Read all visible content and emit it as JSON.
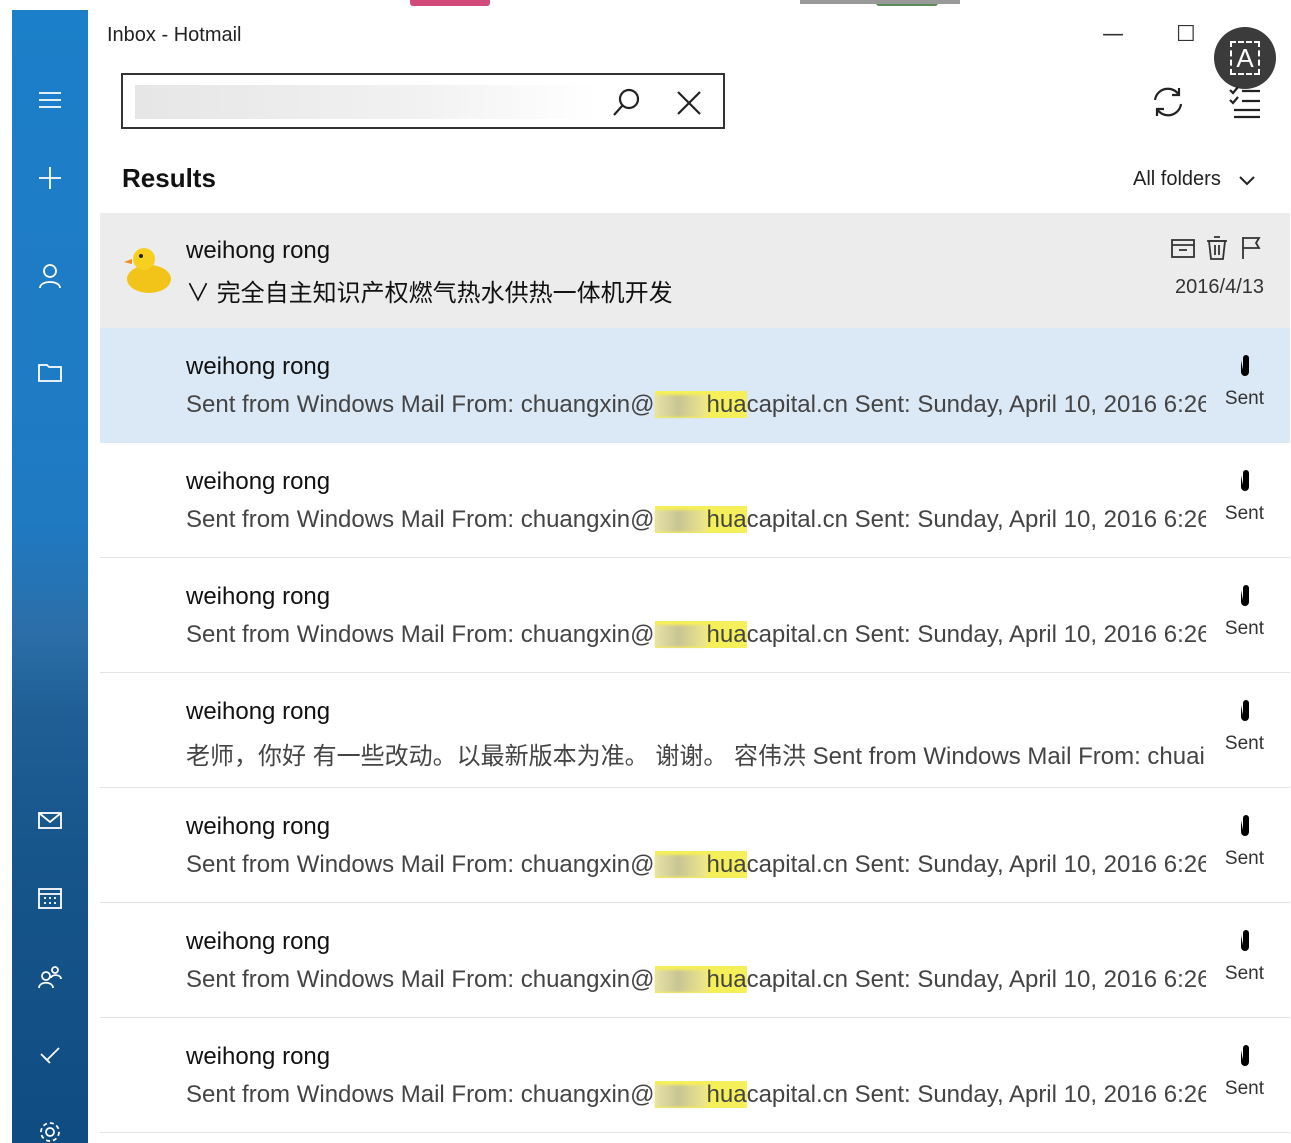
{
  "window": {
    "title": "Inbox - Hotmail",
    "minimize_glyph": "—",
    "maximize_glyph": "☐",
    "avatar_glyph": "A"
  },
  "rail": {
    "items": [
      {
        "icon": "hamburger-icon"
      },
      {
        "icon": "plus-icon"
      },
      {
        "icon": "person-icon"
      },
      {
        "icon": "folder-icon"
      },
      {
        "icon": "mail-icon"
      },
      {
        "icon": "calendar-icon"
      },
      {
        "icon": "people-icon"
      },
      {
        "icon": "todo-icon"
      },
      {
        "icon": "gear-icon"
      }
    ],
    "colors": {
      "top": "#1c7fc9",
      "bottom": "#0f4c82"
    }
  },
  "search": {
    "value": "",
    "placeholder": ""
  },
  "results_header": {
    "title": "Results",
    "folder_filter": "All folders"
  },
  "messages": [
    {
      "sender": "weihong rong",
      "subject": "∨ 完全自主知识产权燃气热水供热一体机开发",
      "date": "2016/4/13"
    },
    {
      "sender": "weihong rong",
      "preview_pre": "Sent from Windows Mail From: chuangxin@",
      "preview_hl": "hua",
      "preview_post": "capital.cn Sent: Sunday, April 10, 2016 6:26",
      "folder": "Sent"
    },
    {
      "sender": "weihong rong",
      "preview_pre": "Sent from Windows Mail From: chuangxin@",
      "preview_hl": "hua",
      "preview_post": "capital.cn Sent: Sunday, April 10, 2016 6:26",
      "folder": "Sent"
    },
    {
      "sender": "weihong rong",
      "preview_pre": "Sent from Windows Mail From: chuangxin@",
      "preview_hl": "hua",
      "preview_post": "capital.cn Sent: Sunday, April 10, 2016 6:26",
      "folder": "Sent"
    },
    {
      "sender": "weihong rong",
      "preview_text": "老师，你好 有一些改动。以最新版本为准。 谢谢。 容伟洪 Sent from Windows Mail From: chuai",
      "folder": "Sent"
    },
    {
      "sender": "weihong rong",
      "preview_pre": "Sent from Windows Mail From: chuangxin@",
      "preview_hl": "hua",
      "preview_post": "capital.cn Sent: Sunday, April 10, 2016 6:26",
      "folder": "Sent"
    },
    {
      "sender": "weihong rong",
      "preview_pre": "Sent from Windows Mail From: chuangxin@",
      "preview_hl": "hua",
      "preview_post": "capital.cn Sent: Sunday, April 10, 2016 6:26",
      "folder": "Sent"
    },
    {
      "sender": "weihong rong",
      "preview_pre": "Sent from Windows Mail From: chuangxin@",
      "preview_hl": "hua",
      "preview_post": "capital.cn Sent: Sunday, April 10, 2016 6:26",
      "folder": "Sent"
    }
  ],
  "colors": {
    "selected_row": "#dbe8f6",
    "hover_row": "#ececec",
    "highlight": "#f5ef5a"
  }
}
